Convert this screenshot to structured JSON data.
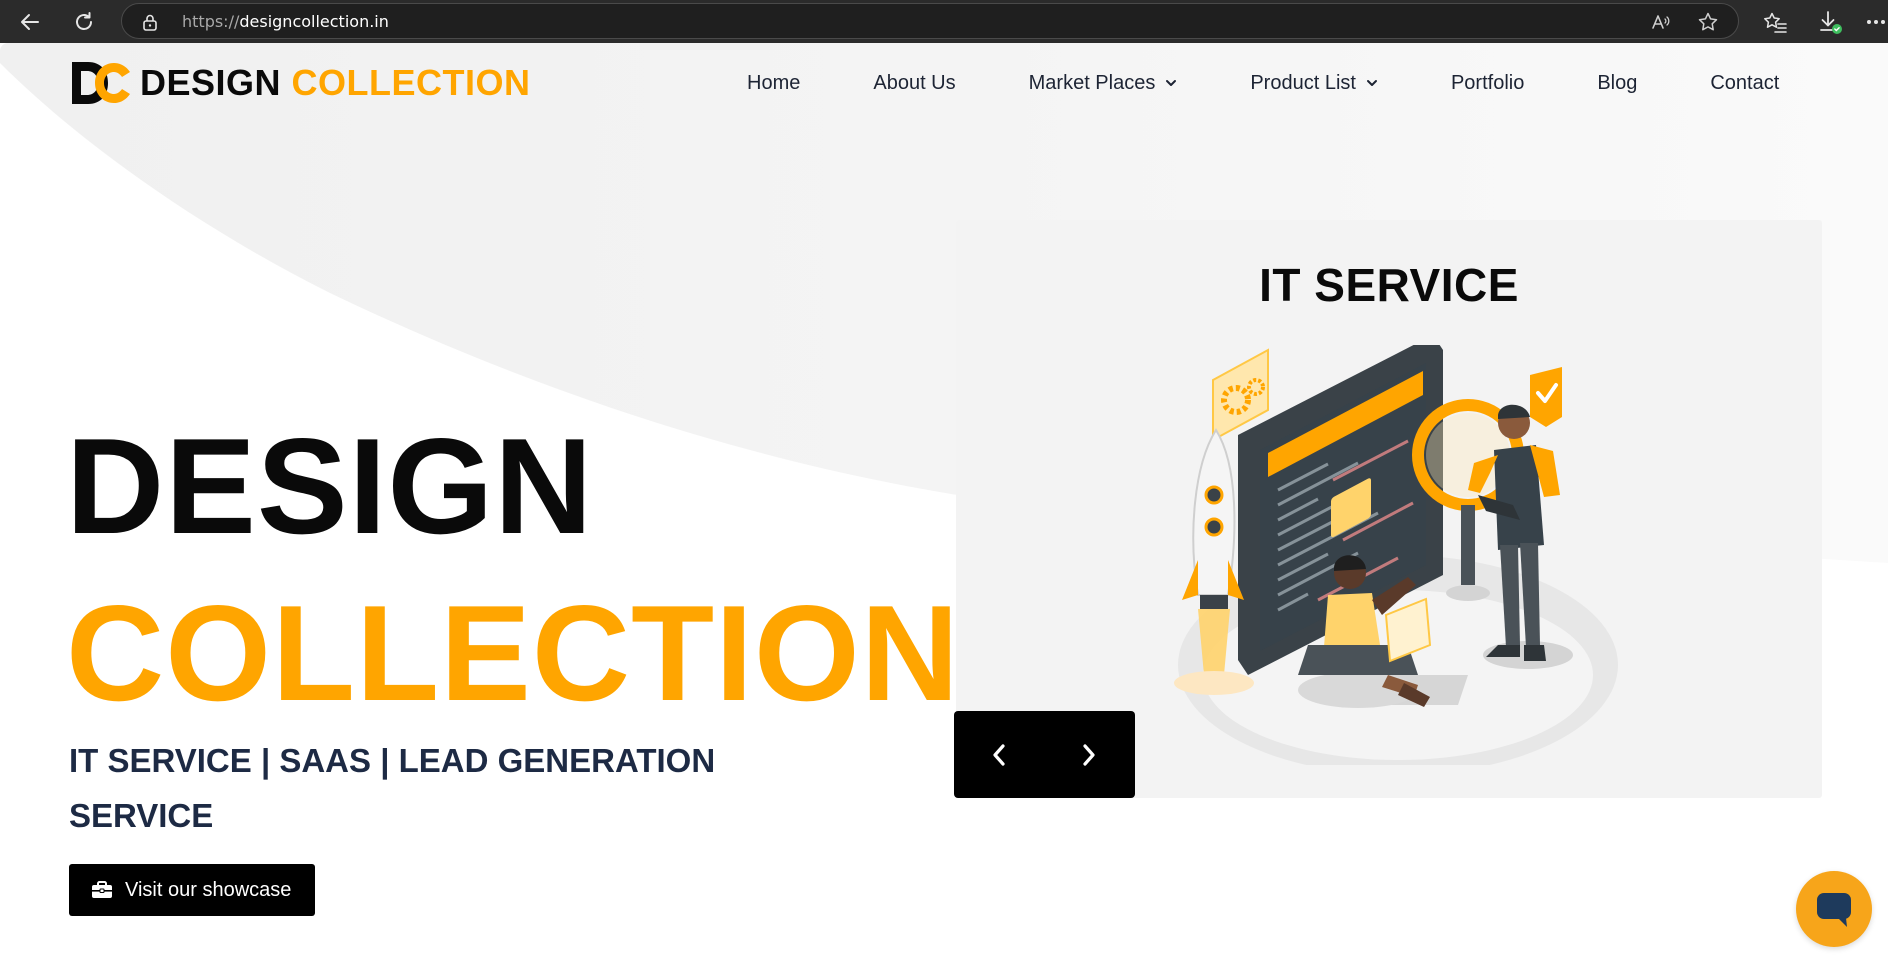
{
  "browser": {
    "url_scheme": "https://",
    "url_host": "designcollection.in",
    "icons": {
      "back": "arrow-left-icon",
      "refresh": "refresh-icon",
      "lock": "lock-icon",
      "read_aloud": "read-aloud-icon",
      "favorite": "star-icon",
      "favorites": "favorites-list-icon",
      "downloads": "download-icon",
      "more": "more-dots-icon"
    }
  },
  "header": {
    "logo_word_1": "DESIGN",
    "logo_word_2": "COLLECTION",
    "nav": [
      {
        "label": "Home",
        "has_dropdown": false
      },
      {
        "label": "About Us",
        "has_dropdown": false
      },
      {
        "label": "Market Places",
        "has_dropdown": true
      },
      {
        "label": "Product List",
        "has_dropdown": true
      },
      {
        "label": "Portfolio",
        "has_dropdown": false
      },
      {
        "label": "Blog",
        "has_dropdown": false
      },
      {
        "label": "Contact",
        "has_dropdown": false
      }
    ]
  },
  "hero": {
    "title_line_1": "DESIGN",
    "title_line_2": "COLLECTION",
    "subtitle": "IT SERVICE | SAAS | LEAD GENERATION SERVICE",
    "cta_label": "Visit our showcase",
    "cta_icon": "briefcase-icon"
  },
  "slider": {
    "current_slide_title": "IT SERVICE",
    "prev_icon": "chevron-left-icon",
    "next_icon": "chevron-right-icon"
  },
  "chat_widget": {
    "icon": "chat-bubble-icon"
  },
  "colors": {
    "brand_orange": "#ffa500",
    "text_dark": "#0a0a0a",
    "subtitle_navy": "#1d2a44",
    "chrome_bg": "#2b2b2b",
    "slide_bg": "#f3f3f3"
  }
}
